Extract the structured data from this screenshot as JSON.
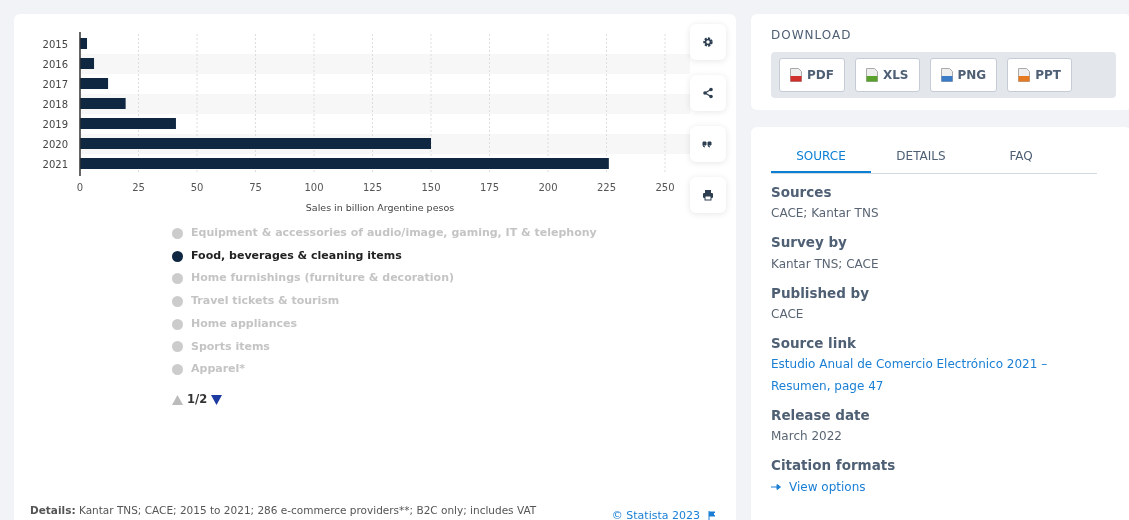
{
  "chart": {
    "chart_data": {
      "type": "bar",
      "orientation": "horizontal",
      "xlabel": "Sales in billion Argentine pesos",
      "categories": [
        "2015",
        "2016",
        "2017",
        "2018",
        "2019",
        "2020",
        "2021"
      ],
      "grid": true,
      "series": [
        {
          "color": "#0f2741",
          "values": [
            3,
            6,
            12,
            19.5,
            41,
            150,
            226
          ]
        }
      ],
      "xlim": [
        0,
        250
      ],
      "xticks": [
        0,
        25,
        50,
        75,
        100,
        125,
        150,
        175,
        200,
        225,
        250
      ]
    }
  },
  "toolbar": [
    {
      "kind": "settings"
    },
    {
      "kind": "share"
    },
    {
      "kind": "quote"
    },
    {
      "kind": "print"
    }
  ],
  "legend": {
    "items": [
      {
        "label": "Equipment & accessories of audio/image, gaming, IT & telephony",
        "selected": false
      },
      {
        "label": "Food, beverages & cleaning items",
        "selected": true
      },
      {
        "label": "Home furnishings (furniture & decoration)",
        "selected": false
      },
      {
        "label": "Travel tickets & tourism",
        "selected": false
      },
      {
        "label": "Home appliances",
        "selected": false
      },
      {
        "label": "Sports items",
        "selected": false
      },
      {
        "label": "Apparel*",
        "selected": false
      }
    ],
    "pager": {
      "text": "1/2",
      "up_disabled": true,
      "down_disabled": false
    }
  },
  "details": "**Details:** Kantar TNS; CACE; 2015 to 2021; 286 e-commerce providers**; B2C only; includes VAT",
  "copyright": "© Statista 2023",
  "download": {
    "title": "DOWNLOAD",
    "buttons": [
      {
        "label": "PDF",
        "kind": "pdf"
      },
      {
        "label": "XLS",
        "kind": "xls"
      },
      {
        "label": "PNG",
        "kind": "png"
      },
      {
        "label": "PPT",
        "kind": "ppt"
      }
    ]
  },
  "tabs": [
    {
      "label": "SOURCE",
      "selected": true
    },
    {
      "label": "DETAILS",
      "selected": false
    },
    {
      "label": "FAQ",
      "selected": false
    }
  ],
  "source": [
    {
      "heading": "Sources",
      "value": "CACE; Kantar TNS",
      "kind": "text"
    },
    {
      "heading": "Survey by",
      "value": "Kantar TNS; CACE",
      "kind": "text"
    },
    {
      "heading": "Published by",
      "value": "CACE",
      "kind": "text"
    },
    {
      "heading": "Source link",
      "value": "Estudio Anual de Comercio Electrónico 2021 – Resumen, page 47",
      "kind": "link"
    },
    {
      "heading": "Release date",
      "value": "March 2022",
      "kind": "text"
    },
    {
      "heading": "Citation formats",
      "value": "View options",
      "kind": "action"
    }
  ]
}
